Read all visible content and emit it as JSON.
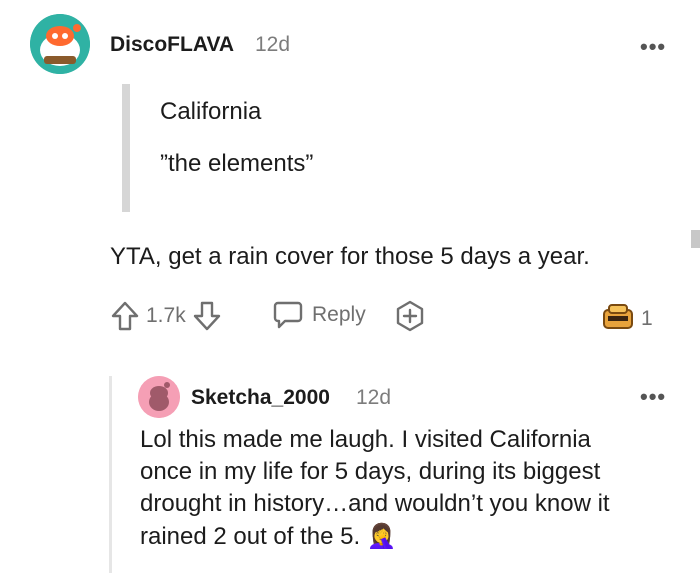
{
  "comment": {
    "username": "DiscoFLAVA",
    "age": "12d",
    "more_label": "•••",
    "quote_lines": [
      "California",
      "”the elements”"
    ],
    "body": "YTA, get a rain cover for those 5 days a year.",
    "vote_count": "1.7k",
    "reply_label": "Reply",
    "award_count": "1"
  },
  "reply": {
    "username": "Sketcha_2000",
    "age": "12d",
    "more_label": "•••",
    "body_lines": [
      "Lol this made me laugh. I visited California",
      "once in my life for 5 days, during its biggest",
      "drought in history…and wouldn’t you know it",
      "rained 2 out of the 5."
    ],
    "emoji": "🤦‍♀️"
  },
  "colors": {
    "avatar_main_bg": "#2fb2a4",
    "avatar_reply_bg": "#f59fb5",
    "award_gold": "#e8a33c",
    "action_gray": "#6f6f6f"
  },
  "icons": {
    "upvote": "upvote-arrow-icon",
    "downvote": "downvote-arrow-icon",
    "reply": "speech-bubble-icon",
    "award": "plus-award-icon",
    "award_received": "gold-award-icon"
  }
}
